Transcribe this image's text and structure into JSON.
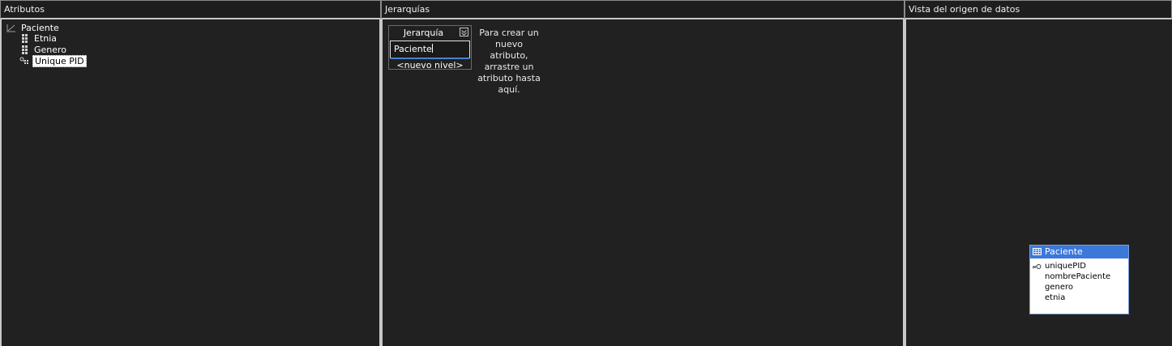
{
  "panes": {
    "attributes": {
      "title": "Atributos"
    },
    "hierarchies": {
      "title": "Jerarquías"
    },
    "dsv": {
      "title": "Vista del origen de datos"
    }
  },
  "attribute_tree": {
    "root": {
      "label": "Paciente",
      "icon": "dimension-icon"
    },
    "children": [
      {
        "label": "Etnia",
        "icon": "attribute-icon",
        "selected": false
      },
      {
        "label": "Genero",
        "icon": "attribute-icon",
        "selected": false
      },
      {
        "label": "Unique PID",
        "icon": "key-attribute-icon",
        "selected": true
      }
    ]
  },
  "hierarchy": {
    "title": "Jerarquía",
    "level_value": "Paciente",
    "new_level": "<nuevo nivel>",
    "hint": "Para crear un nuevo atributo, arrastre un atributo hasta aquí."
  },
  "dsv_table": {
    "name": "Paciente",
    "columns": [
      {
        "name": "uniquePID",
        "is_key": true
      },
      {
        "name": "nombrePaciente",
        "is_key": false
      },
      {
        "name": "genero",
        "is_key": false
      },
      {
        "name": "etnia",
        "is_key": false
      }
    ]
  },
  "colors": {
    "background": "#212121",
    "accent": "#3c78d8",
    "divider": "#c8c8c8"
  }
}
